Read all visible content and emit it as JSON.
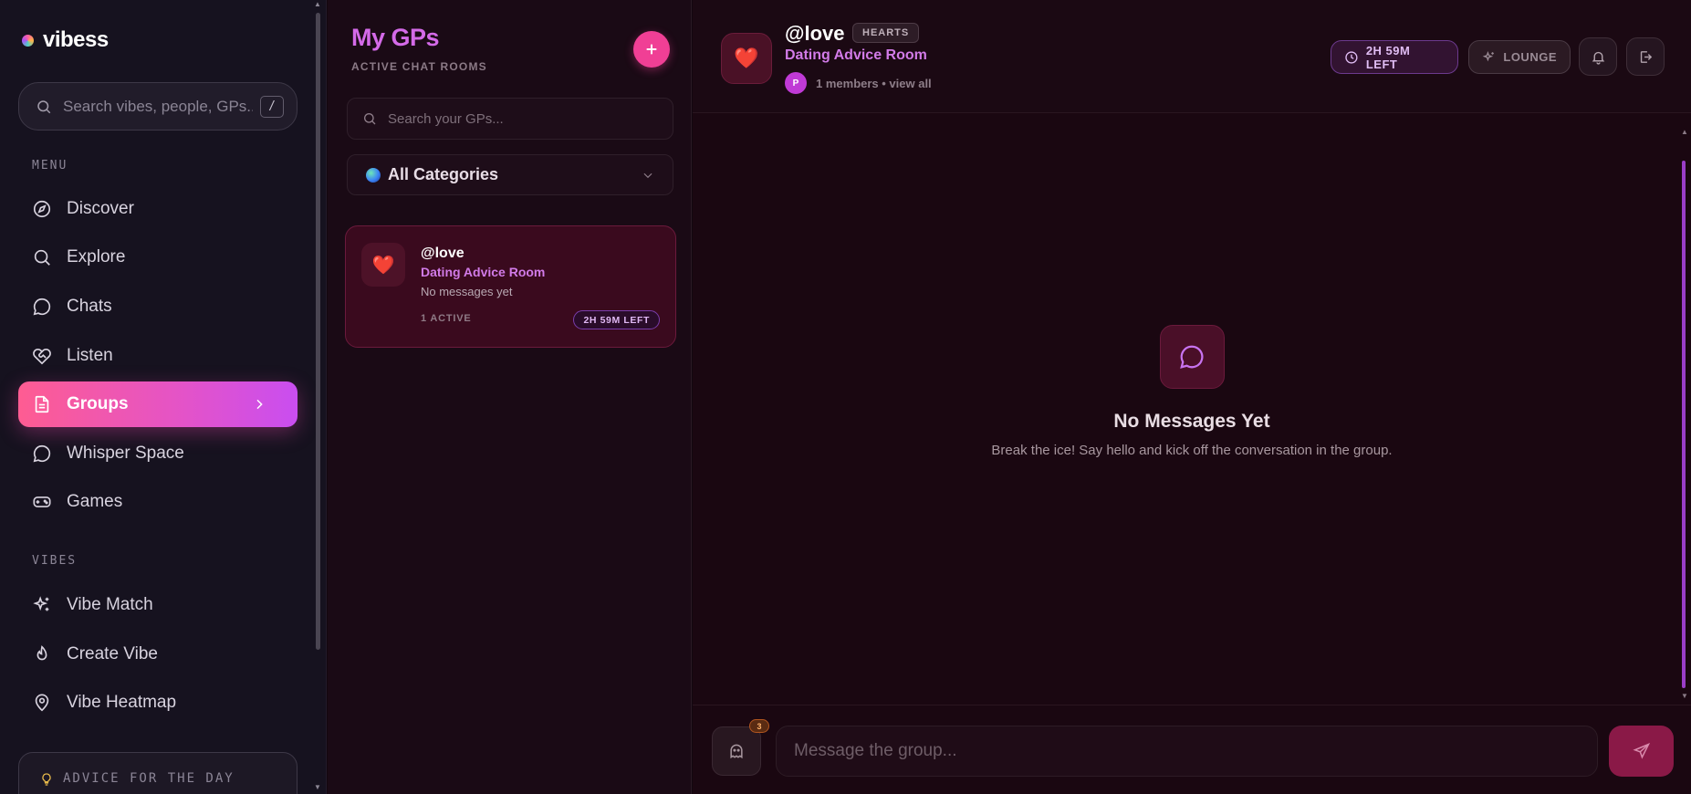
{
  "app": {
    "name": "vibess"
  },
  "sidebar": {
    "search": {
      "placeholder": "Search vibes, people, GPs...",
      "shortcut": "/"
    },
    "menu_label": "MENU",
    "menu_items": [
      {
        "label": "Discover",
        "icon": "compass-icon"
      },
      {
        "label": "Explore",
        "icon": "search-icon"
      },
      {
        "label": "Chats",
        "icon": "chat-bubble-icon"
      },
      {
        "label": "Listen",
        "icon": "heart-handshake-icon"
      },
      {
        "label": "Groups",
        "icon": "document-icon",
        "active": true
      },
      {
        "label": "Whisper Space",
        "icon": "chat-bubble-icon"
      },
      {
        "label": "Games",
        "icon": "gamepad-icon"
      }
    ],
    "vibes_label": "VIBES",
    "vibe_items": [
      {
        "label": "Vibe Match",
        "icon": "sparkles-icon"
      },
      {
        "label": "Create Vibe",
        "icon": "flame-icon"
      },
      {
        "label": "Vibe Heatmap",
        "icon": "map-pin-icon"
      }
    ],
    "advice_label": "ADVICE FOR THE DAY"
  },
  "gp_panel": {
    "title": "My GPs",
    "subtitle": "ACTIVE CHAT ROOMS",
    "search_placeholder": "Search your GPs...",
    "category": "All Categories",
    "groups": [
      {
        "name": "@love",
        "room": "Dating Advice Room",
        "preview": "No messages yet",
        "active": "1 ACTIVE",
        "time_left": "2H 59M LEFT",
        "emoji": "❤️"
      }
    ]
  },
  "chat": {
    "header": {
      "emoji": "❤️",
      "name": "@love",
      "badge": "HEARTS",
      "room": "Dating Advice Room",
      "member_initial": "P",
      "members": "1 members • view all",
      "time_left": "2H 59M LEFT",
      "lounge": "LOUNGE"
    },
    "empty": {
      "title": "No Messages Yet",
      "text": "Break the ice! Say hello and kick off the conversation in the group."
    },
    "composer": {
      "ghost_count": "3",
      "placeholder": "Message the group..."
    }
  },
  "colors": {
    "accent_pink": "#f03f95",
    "accent_purple": "#d27be8",
    "active_gradient_start": "#fe5c92",
    "active_gradient_end": "#c94ef0"
  }
}
